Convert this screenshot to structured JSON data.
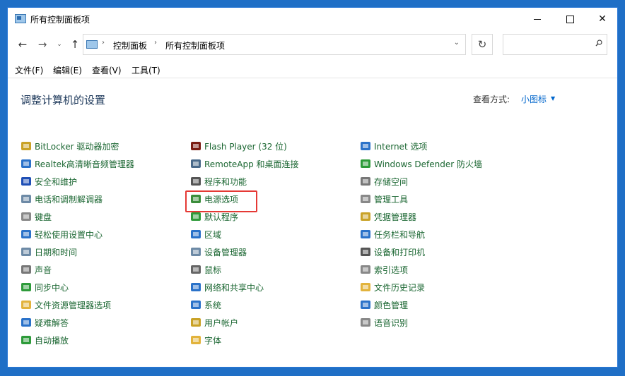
{
  "window": {
    "title": "所有控制面板项"
  },
  "nav": {
    "back": "←",
    "forward": "→",
    "dropdown": "⌄",
    "up": "↑",
    "breadcrumb": [
      "控制面板",
      "所有控制面板项"
    ],
    "refresh": "↻",
    "search_placeholder": ""
  },
  "menu": [
    "文件(F)",
    "编辑(E)",
    "查看(V)",
    "工具(T)"
  ],
  "header": {
    "title": "调整计算机的设置",
    "view_label": "查看方式:",
    "view_value": "小图标"
  },
  "columns": [
    [
      {
        "label": "BitLocker 驱动器加密",
        "icon": "bitlocker-icon",
        "color": "#c9a227"
      },
      {
        "label": "Realtek高清晰音频管理器",
        "icon": "realtek-audio-icon",
        "color": "#2a72c9"
      },
      {
        "label": "安全和维护",
        "icon": "flag-icon",
        "color": "#1f4fb5"
      },
      {
        "label": "电话和调制解调器",
        "icon": "phone-modem-icon",
        "color": "#6d8aa6"
      },
      {
        "label": "键盘",
        "icon": "keyboard-icon",
        "color": "#888888"
      },
      {
        "label": "轻松使用设置中心",
        "icon": "ease-of-access-icon",
        "color": "#2a72c9"
      },
      {
        "label": "日期和时间",
        "icon": "date-time-icon",
        "color": "#6d8aa6"
      },
      {
        "label": "声音",
        "icon": "speaker-icon",
        "color": "#777777"
      },
      {
        "label": "同步中心",
        "icon": "sync-center-icon",
        "color": "#2e9b3a"
      },
      {
        "label": "文件资源管理器选项",
        "icon": "folder-options-icon",
        "color": "#e2b33c"
      },
      {
        "label": "疑难解答",
        "icon": "troubleshoot-icon",
        "color": "#2a72c9"
      },
      {
        "label": "自动播放",
        "icon": "autoplay-icon",
        "color": "#2e9b3a"
      }
    ],
    [
      {
        "label": "Flash Player (32 位)",
        "icon": "flash-player-icon",
        "color": "#7a1c12"
      },
      {
        "label": "RemoteApp 和桌面连接",
        "icon": "remoteapp-icon",
        "color": "#4a6a8a"
      },
      {
        "label": "程序和功能",
        "icon": "programs-features-icon",
        "color": "#555555"
      },
      {
        "label": "电源选项",
        "icon": "power-options-icon",
        "color": "#3b8d3b"
      },
      {
        "label": "默认程序",
        "icon": "default-programs-icon",
        "color": "#2e9b3a"
      },
      {
        "label": "区域",
        "icon": "region-icon",
        "color": "#2a72c9"
      },
      {
        "label": "设备管理器",
        "icon": "device-manager-icon",
        "color": "#6d8aa6"
      },
      {
        "label": "鼠标",
        "icon": "mouse-icon",
        "color": "#666666"
      },
      {
        "label": "网络和共享中心",
        "icon": "network-sharing-icon",
        "color": "#2a72c9"
      },
      {
        "label": "系统",
        "icon": "system-icon",
        "color": "#2a72c9"
      },
      {
        "label": "用户帐户",
        "icon": "user-accounts-icon",
        "color": "#c9a227"
      },
      {
        "label": "字体",
        "icon": "fonts-icon",
        "color": "#e2b33c"
      }
    ],
    [
      {
        "label": "Internet 选项",
        "icon": "internet-options-icon",
        "color": "#2a72c9"
      },
      {
        "label": "Windows Defender 防火墙",
        "icon": "firewall-icon",
        "color": "#2e9b3a"
      },
      {
        "label": "存储空间",
        "icon": "storage-spaces-icon",
        "color": "#777777"
      },
      {
        "label": "管理工具",
        "icon": "admin-tools-icon",
        "color": "#888888"
      },
      {
        "label": "凭据管理器",
        "icon": "credential-manager-icon",
        "color": "#c9a227"
      },
      {
        "label": "任务栏和导航",
        "icon": "taskbar-icon",
        "color": "#2a72c9"
      },
      {
        "label": "设备和打印机",
        "icon": "devices-printers-icon",
        "color": "#555555"
      },
      {
        "label": "索引选项",
        "icon": "indexing-options-icon",
        "color": "#888888"
      },
      {
        "label": "文件历史记录",
        "icon": "file-history-icon",
        "color": "#e2b33c"
      },
      {
        "label": "颜色管理",
        "icon": "color-management-icon",
        "color": "#2a72c9"
      },
      {
        "label": "语音识别",
        "icon": "speech-recognition-icon",
        "color": "#888888"
      }
    ]
  ]
}
